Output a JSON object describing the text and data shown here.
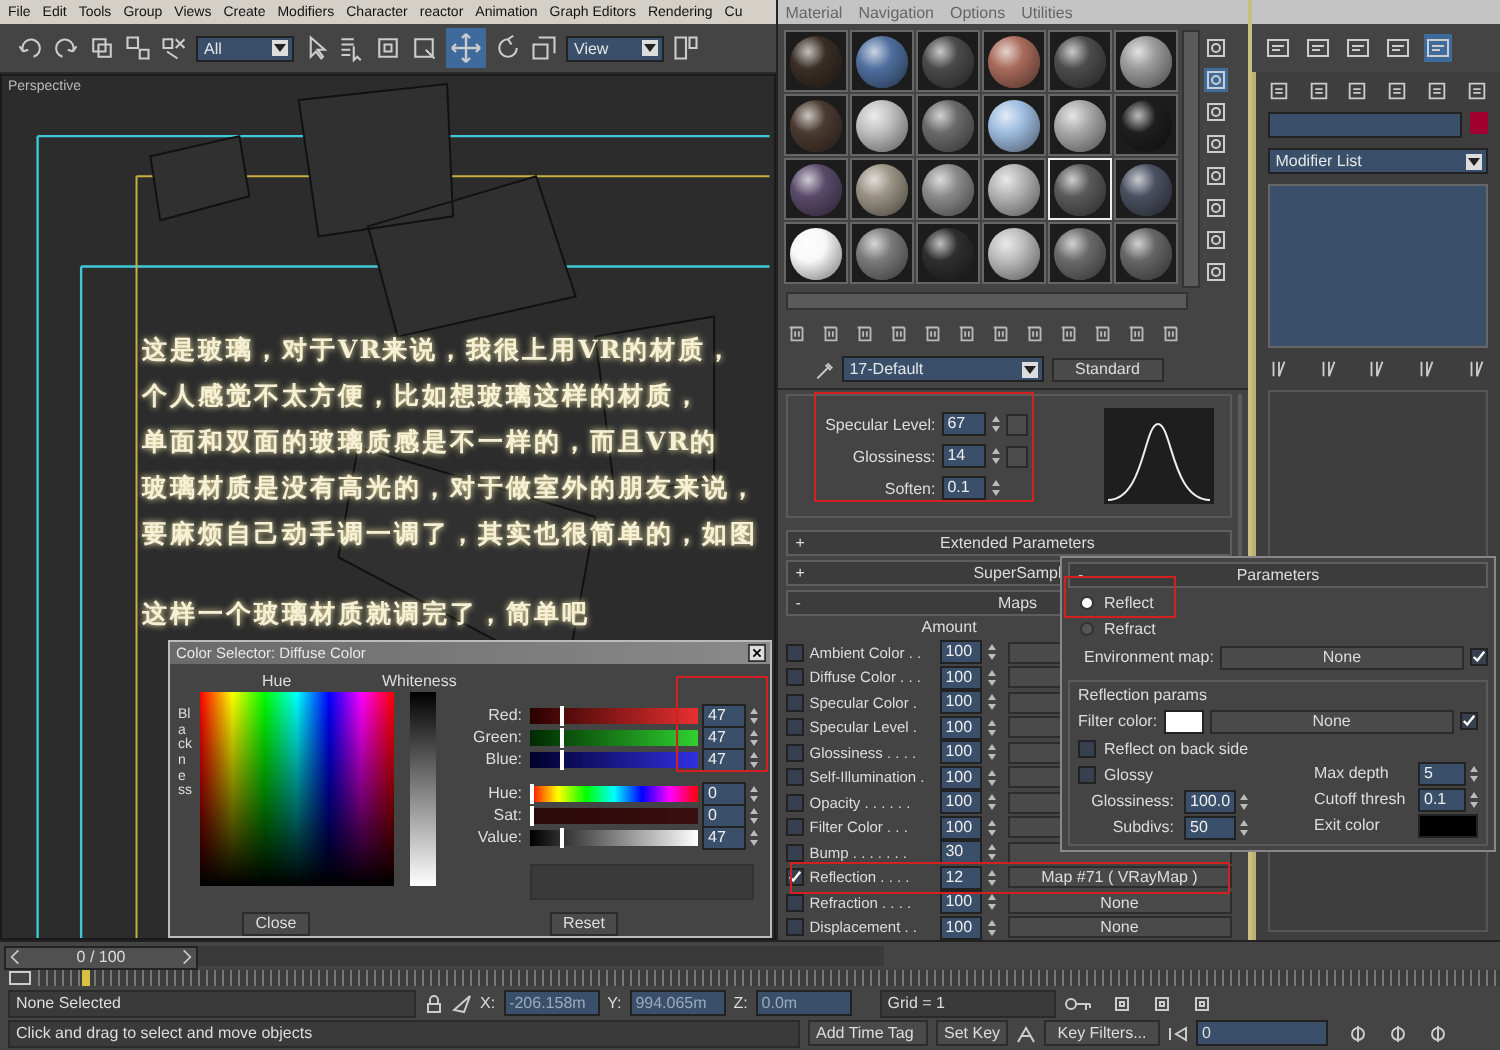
{
  "menu_bar": {
    "items": [
      "File",
      "Edit",
      "Tools",
      "Group",
      "Views",
      "Create",
      "Modifiers",
      "Character",
      "reactor",
      "Animation",
      "Graph Editors",
      "Rendering",
      "Cu"
    ]
  },
  "main_toolbar": {
    "selection_filter": "All",
    "reference_coordinate": "View"
  },
  "viewport": {
    "label": "Perspective",
    "paragraphs": [
      [
        "这是玻璃，对于VR来说，我很上用VR的材质，",
        "个人感觉不太方便，比如想玻璃这样的材质，",
        "单面和双面的玻璃质感是不一样的，而且VR的",
        "玻璃材质是没有高光的，对于做室外的朋友来说，",
        "要麻烦自己动手调一调了，其实也很简单的，如图"
      ],
      [
        "这样一个玻璃材质就调完了，简单吧"
      ]
    ]
  },
  "material_editor": {
    "menu": [
      "Material",
      "Navigation",
      "Options",
      "Utilities"
    ],
    "samples": [
      {
        "color": "#3a2e26",
        "selected": false
      },
      {
        "color": "#4f6f9e",
        "selected": false
      },
      {
        "color": "#4a4a4a",
        "selected": false
      },
      {
        "color": "#a86a5a",
        "selected": false
      },
      {
        "color": "#4c4c4c",
        "selected": false
      },
      {
        "color": "#9a9a9a",
        "selected": false
      },
      {
        "color": "#4a3a30",
        "selected": false
      },
      {
        "color": "#c0c0c0",
        "selected": false
      },
      {
        "color": "#6a6a6a",
        "selected": false
      },
      {
        "color": "#9fbde0",
        "selected": false
      },
      {
        "color": "#a8a8a8",
        "selected": false
      },
      {
        "color": "#1e1e1e",
        "selected": false
      },
      {
        "color": "#5a4a6a",
        "selected": false
      },
      {
        "color": "#9a9284",
        "selected": false
      },
      {
        "color": "#8a8a8a",
        "selected": false
      },
      {
        "color": "#b4b4b4",
        "selected": false
      },
      {
        "color": "#5a5a5a",
        "selected": true
      },
      {
        "color": "#4a5060",
        "selected": false
      },
      {
        "color": "#f8f8f8",
        "selected": false
      },
      {
        "color": "#7a7a7a",
        "selected": false
      },
      {
        "color": "#2e2e2e",
        "selected": false
      },
      {
        "color": "#bcbcbc",
        "selected": false
      },
      {
        "color": "#6a6a6a",
        "selected": false
      },
      {
        "color": "#666666",
        "selected": false
      }
    ],
    "material_name": "17-Default",
    "material_type": "Standard",
    "specular": [
      {
        "label": "Specular Level:",
        "value": "67",
        "mapped": true
      },
      {
        "label": "Glossiness:",
        "value": "14",
        "mapped": true
      },
      {
        "label": "Soften:",
        "value": "0.1",
        "mapped": false
      }
    ],
    "rollouts": [
      {
        "sign": "+",
        "title": "Extended Parameters"
      },
      {
        "sign": "+",
        "title": "SuperSampl"
      },
      {
        "sign": "-",
        "title": "Maps"
      }
    ],
    "amount_header": "Amount",
    "maps": [
      {
        "label": "Ambient Color . .",
        "amount": "100",
        "checked": false
      },
      {
        "label": "Diffuse Color . . .",
        "amount": "100",
        "checked": false
      },
      {
        "label": "Specular Color .",
        "amount": "100",
        "checked": false
      },
      {
        "label": "Specular Level .",
        "amount": "100",
        "checked": false
      },
      {
        "label": "Glossiness . . . .",
        "amount": "100",
        "checked": false
      },
      {
        "label": "Self-Illumination .",
        "amount": "100",
        "checked": false
      },
      {
        "label": "Opacity . . . . . .",
        "amount": "100",
        "checked": false
      },
      {
        "label": "Filter Color . . .",
        "amount": "100",
        "checked": false
      },
      {
        "label": "Bump . . . . . . .",
        "amount": "30",
        "checked": false
      },
      {
        "label": "Reflection . . . .",
        "amount": "12",
        "checked": true,
        "map": "Map #71  ( VRayMap )"
      },
      {
        "label": "Refraction . . . .",
        "amount": "100",
        "checked": false,
        "map": "None"
      },
      {
        "label": "Displacement . .",
        "amount": "100",
        "checked": false,
        "map": "None"
      }
    ]
  },
  "color_selector": {
    "title": "Color Selector: Diffuse Color",
    "hue_label": "Hue",
    "whiteness_label": "Whiteness",
    "blackness_label": "Blackness",
    "channels": [
      {
        "kind": "red",
        "label": "Red:",
        "value": "47",
        "level": 0.18
      },
      {
        "kind": "green",
        "label": "Green:",
        "value": "47",
        "level": 0.18
      },
      {
        "kind": "blue",
        "label": "Blue:",
        "value": "47",
        "level": 0.18
      },
      {
        "kind": "hue",
        "label": "Hue:",
        "value": "0",
        "level": 0
      },
      {
        "kind": "sat",
        "label": "Sat:",
        "value": "0",
        "level": 0
      },
      {
        "kind": "value",
        "label": "Value:",
        "value": "47",
        "level": 0.18
      }
    ],
    "buttons": [
      "Close",
      "Reset"
    ]
  },
  "reflection_map": {
    "sign": "-",
    "title": "Parameters",
    "modes": [
      {
        "label": "Reflect",
        "selected": true
      },
      {
        "label": "Refract",
        "selected": false
      }
    ],
    "environment_map": {
      "label": "Environment map:",
      "map": "None",
      "checked": true
    },
    "group_title": "Reflection params",
    "filter_color": {
      "label": "Filter color:",
      "map": "None",
      "checked": true
    },
    "options": [
      {
        "label": "Reflect on back side",
        "checked": false
      },
      {
        "label": "Glossy",
        "checked": false
      }
    ],
    "left_fields": [
      {
        "label": "Glossiness:",
        "value": "100.0"
      },
      {
        "label": "Subdivs:",
        "value": "50"
      }
    ],
    "right_fields": [
      {
        "label": "Max depth",
        "value": "5"
      },
      {
        "label": "Cutoff thresh",
        "value": "0.1"
      }
    ],
    "exit_color_label": "Exit color"
  },
  "command_panel": {
    "modifier_list": "Modifier List"
  },
  "time_slider": {
    "frame": "0 / 100",
    "level": 0
  },
  "status_bar": {
    "selection": "None Selected",
    "prompt": "Click and drag to select and move objects",
    "coords": [
      {
        "axis": "X:",
        "value": "-206.158m"
      },
      {
        "axis": "Y:",
        "value": "994.065m"
      },
      {
        "axis": "Z:",
        "value": "0.0m"
      }
    ],
    "grid": "Grid = 1",
    "add_time_tag": "Add Time Tag",
    "set_key": "Set Key",
    "key_filters": "Key Filters...",
    "frame": "0"
  }
}
